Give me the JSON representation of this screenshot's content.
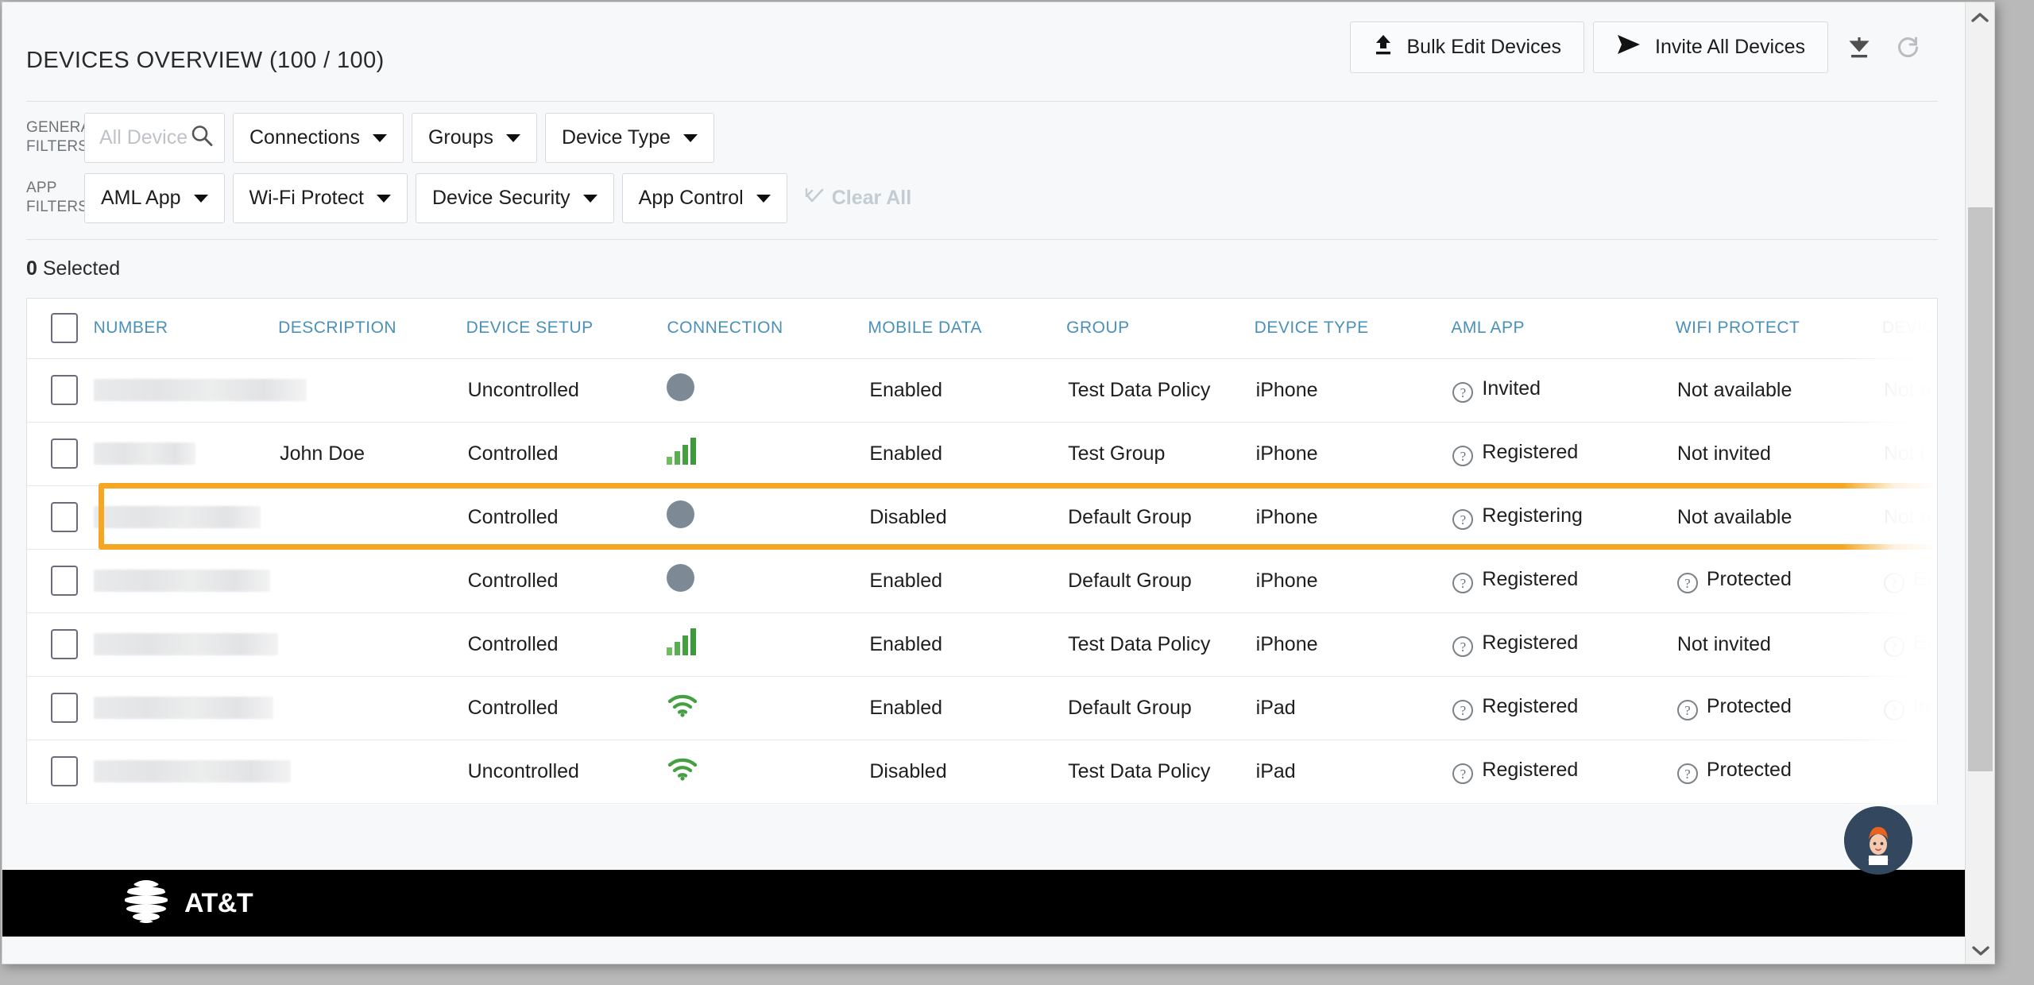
{
  "header": {
    "title": "DEVICES OVERVIEW (100 / 100)",
    "bulk_edit_label": "Bulk Edit Devices",
    "invite_all_label": "Invite All Devices",
    "download_icon": "download-icon",
    "refresh_icon": "refresh-icon",
    "upload_icon": "upload-icon",
    "send_icon": "send-icon"
  },
  "filters": {
    "general_label_line1": "GENERAL",
    "general_label_line2": "FILTERS",
    "app_label_line1": "APP",
    "app_label_line2": "FILTERS",
    "search_placeholder": "All Devices",
    "search_value": "",
    "general": [
      {
        "label": "Connections"
      },
      {
        "label": "Groups"
      },
      {
        "label": "Device Type"
      }
    ],
    "app": [
      {
        "label": "AML App"
      },
      {
        "label": "Wi-Fi Protect"
      },
      {
        "label": "Device Security"
      },
      {
        "label": "App Control"
      }
    ],
    "clear_all_label": "Clear All"
  },
  "selection": {
    "count": "0",
    "label": "Selected"
  },
  "table": {
    "columns": [
      "NUMBER",
      "DESCRIPTION",
      "DEVICE SETUP",
      "CONNECTION",
      "MOBILE DATA",
      "GROUP",
      "DEVICE TYPE",
      "AML APP",
      "WIFI PROTECT",
      "DEVICE SE"
    ],
    "rows": [
      {
        "number": "",
        "description": "",
        "setup": "Uncontrolled",
        "connection": "offline",
        "mobile_data": "Enabled",
        "group": "Test Data Policy",
        "device_type": "iPhone",
        "aml_app": "Invited",
        "aml_help": true,
        "wifi_protect": "Not available",
        "wifi_help": false,
        "device_security": "Not a",
        "dsec_help": false,
        "highlighted": false
      },
      {
        "number": "",
        "description": "John Doe",
        "setup": "Controlled",
        "connection": "cellular",
        "mobile_data": "Enabled",
        "group": "Test Group",
        "device_type": "iPhone",
        "aml_app": "Registered",
        "aml_help": true,
        "wifi_protect": "Not invited",
        "wifi_help": false,
        "device_security": "Not i",
        "dsec_help": false,
        "highlighted": false
      },
      {
        "number": "",
        "description": "",
        "setup": "Controlled",
        "connection": "offline",
        "mobile_data": "Disabled",
        "group": "Default Group",
        "device_type": "iPhone",
        "aml_app": "Registering",
        "aml_help": true,
        "wifi_protect": "Not available",
        "wifi_help": false,
        "device_security": "Not a",
        "dsec_help": false,
        "highlighted": true
      },
      {
        "number": "",
        "description": "",
        "setup": "Controlled",
        "connection": "offline",
        "mobile_data": "Enabled",
        "group": "Default Group",
        "device_type": "iPhone",
        "aml_app": "Registered",
        "aml_help": true,
        "wifi_protect": "Protected",
        "wifi_help": true,
        "device_security": "Enrol",
        "dsec_help": true,
        "highlighted": false
      },
      {
        "number": "",
        "description": "",
        "setup": "Controlled",
        "connection": "cellular",
        "mobile_data": "Enabled",
        "group": "Test Data Policy",
        "device_type": "iPhone",
        "aml_app": "Registered",
        "aml_help": true,
        "wifi_protect": "Not invited",
        "wifi_help": false,
        "device_security": "Enrol",
        "dsec_help": true,
        "highlighted": false
      },
      {
        "number": "",
        "description": "",
        "setup": "Controlled",
        "connection": "wifi",
        "mobile_data": "Enabled",
        "group": "Default Group",
        "device_type": "iPad",
        "aml_app": "Registered",
        "aml_help": true,
        "wifi_protect": "Protected",
        "wifi_help": true,
        "device_security": "Invite",
        "dsec_help": true,
        "highlighted": false
      },
      {
        "number": "",
        "description": "",
        "setup": "Uncontrolled",
        "connection": "wifi",
        "mobile_data": "Disabled",
        "group": "Test Data Policy",
        "device_type": "iPad",
        "aml_app": "Registered",
        "aml_help": true,
        "wifi_protect": "Protected",
        "wifi_help": true,
        "device_security": "",
        "dsec_help": false,
        "highlighted": false
      }
    ]
  },
  "footer": {
    "brand": "AT&T"
  },
  "colors": {
    "highlight": "#f5a623",
    "header_text": "#4a90b9",
    "connection_green": "#45a041",
    "connection_gray": "#7d8a95",
    "avatar_bg": "#33475f",
    "footer_bg": "#000000"
  }
}
